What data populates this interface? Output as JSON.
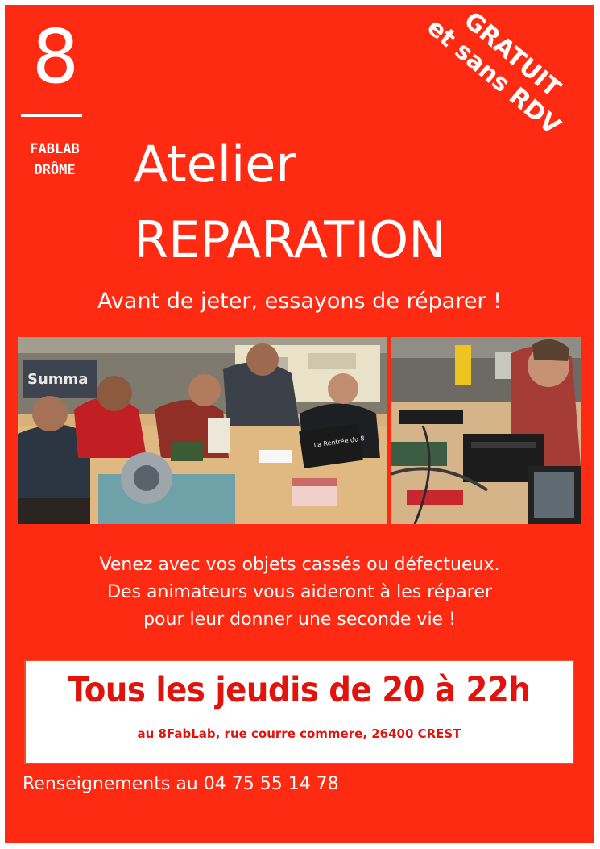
{
  "logo": {
    "number": "8",
    "line1": "FABLAB",
    "line2": "DRÔME"
  },
  "badge": {
    "line1": "GRATUIT",
    "line2": "et sans RDV"
  },
  "title": {
    "line1": "Atelier",
    "line2": "REPARATION"
  },
  "tagline": "Avant de jeter, essayons de réparer !",
  "photos": {
    "left_sign": "Summa",
    "left_box": "La Rentrée du 8"
  },
  "body": {
    "line1": "Venez avec vos objets cassés ou défectueux.",
    "line2": "Des animateurs vous aideront à les réparer",
    "line3": "pour leur donner une seconde vie !"
  },
  "schedule": "Tous les jeudis de 20 à 22h",
  "address": "au 8FabLab, rue courre commere, 26400 CREST",
  "contact": "Renseignements au 04 75 55 14 78",
  "colors": {
    "background": "#ff2a12",
    "accent_text": "#e0140c",
    "text": "#ffffff"
  }
}
